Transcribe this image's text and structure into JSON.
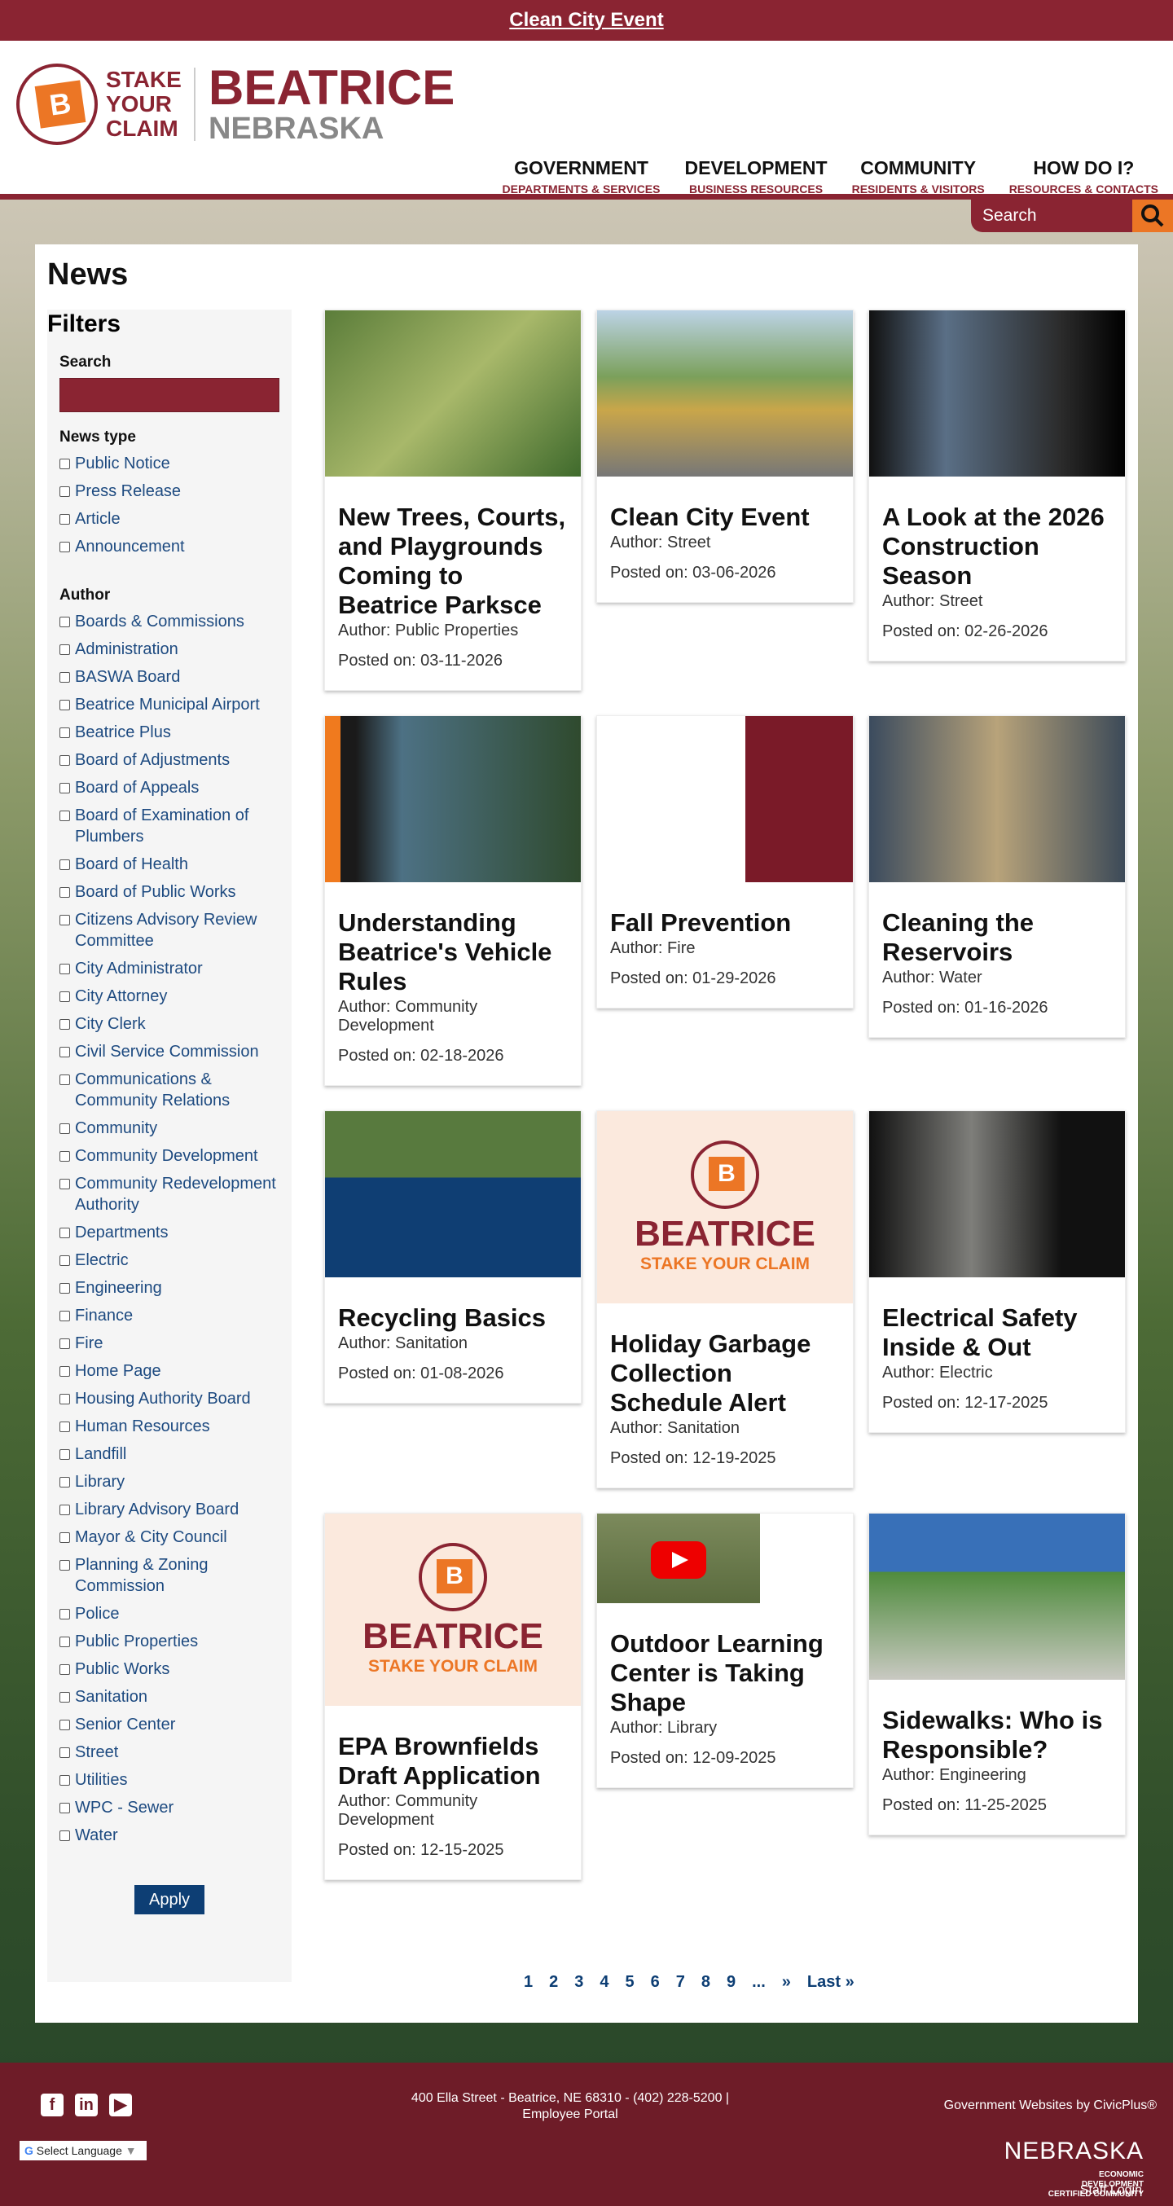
{
  "alert": {
    "text": "Clean City Event"
  },
  "logo": {
    "stake": "STAKE YOUR CLAIM",
    "name": "BEATRICE",
    "state": "NEBRASKA",
    "letter": "B"
  },
  "nav": [
    {
      "title": "GOVERNMENT",
      "sub": "DEPARTMENTS & SERVICES"
    },
    {
      "title": "DEVELOPMENT",
      "sub": "BUSINESS RESOURCES"
    },
    {
      "title": "COMMUNITY",
      "sub": "RESIDENTS & VISITORS"
    },
    {
      "title": "HOW DO I?",
      "sub": "RESOURCES & CONTACTS"
    }
  ],
  "search": {
    "placeholder": "Search"
  },
  "page": {
    "title": "News"
  },
  "filters": {
    "title": "Filters",
    "search_label": "Search",
    "news_type_label": "News type",
    "news_types": [
      "Public Notice",
      "Press Release",
      "Article",
      "Announcement"
    ],
    "author_label": "Author",
    "authors": [
      "Boards & Commissions",
      "Administration",
      "BASWA Board",
      "Beatrice Municipal Airport",
      "Beatrice Plus",
      "Board of Adjustments",
      "Board of Appeals",
      "Board of Examination of Plumbers",
      "Board of Health",
      "Board of Public Works",
      "Citizens Advisory Review Committee",
      "City Administrator",
      "City Attorney",
      "City Clerk",
      "Civil Service Commission",
      "Communications & Community Relations",
      "Community",
      "Community Development",
      "Community Redevelopment Authority",
      "Departments",
      "Electric",
      "Engineering",
      "Finance",
      "Fire",
      "Home Page",
      "Housing Authority Board",
      "Human Resources",
      "Landfill",
      "Library",
      "Library Advisory Board",
      "Mayor & City Council",
      "Planning & Zoning Commission",
      "Police",
      "Public Properties",
      "Public Works",
      "Sanitation",
      "Senior Center",
      "Street",
      "Utilities",
      "WPC - Sewer",
      "Water"
    ],
    "apply": "Apply"
  },
  "cards": [
    {
      "title": "New Trees, Courts, and Playgrounds Coming to Beatrice Parksce",
      "author": "Author: Public Properties",
      "date": "Posted on: 03-11-2026",
      "img": "park"
    },
    {
      "title": "Clean City Event",
      "author": "Author: Street",
      "date": "Posted on: 03-06-2026",
      "img": "photo"
    },
    {
      "title": "A Look at the 2026 Construction Season",
      "author": "Author: Street",
      "date": "Posted on: 02-26-2026",
      "img": "dark"
    },
    {
      "title": "Understanding Beatrice's Vehicle Rules",
      "author": "Author: Community Development",
      "date": "Posted on: 02-18-2026",
      "img": "car"
    },
    {
      "title": "Fall Prevention",
      "author": "Author: Fire",
      "date": "Posted on: 01-29-2026",
      "img": "fire"
    },
    {
      "title": "Cleaning the Reservoirs",
      "author": "Author: Water",
      "date": "Posted on: 01-16-2026",
      "img": "res"
    },
    {
      "title": "Recycling Basics",
      "author": "Author: Sanitation",
      "date": "Posted on: 01-08-2026",
      "img": "recycle"
    },
    {
      "title": "Holiday Garbage Collection Schedule Alert",
      "author": "Author: Sanitation",
      "date": "Posted on: 12-19-2025",
      "img": "logo"
    },
    {
      "title": "Electrical Safety Inside & Out",
      "author": "Author: Electric",
      "date": "Posted on: 12-17-2025",
      "img": "dark2"
    },
    {
      "title": "EPA Brownfields Draft Application",
      "author": "Author: Community Development",
      "date": "Posted on: 12-15-2025",
      "img": "logo"
    },
    {
      "title": "Outdoor Learning Center is Taking Shape",
      "author": "Author: Library",
      "date": "Posted on: 12-09-2025",
      "img": "yt"
    },
    {
      "title": "Sidewalks: Who is Responsible?",
      "author": "Author: Engineering",
      "date": "Posted on: 11-25-2025",
      "img": "sidewalk"
    }
  ],
  "logo_card": {
    "name": "BEATRICE",
    "tag": "STAKE YOUR CLAIM"
  },
  "pagination": [
    "1",
    "2",
    "3",
    "4",
    "5",
    "6",
    "7",
    "8",
    "9",
    "...",
    "»",
    "Last »"
  ],
  "footer": {
    "address": "400 Ella Street - Beatrice, NE 68310 - (402) 228-5200 | Employee Portal",
    "civicplus": "Government Websites by CivicPlus®",
    "language": "Select Language",
    "nebraska": "NEBRASKA",
    "nebraska_sub": "ECONOMIC DEVELOPMENT CERTIFIED COMMUNITY",
    "staff_login": "Staff Login"
  },
  "colors": {
    "brand": "#8a2432",
    "accent": "#ec7625",
    "link": "#1d4a80",
    "footer": "#6e1c28"
  }
}
